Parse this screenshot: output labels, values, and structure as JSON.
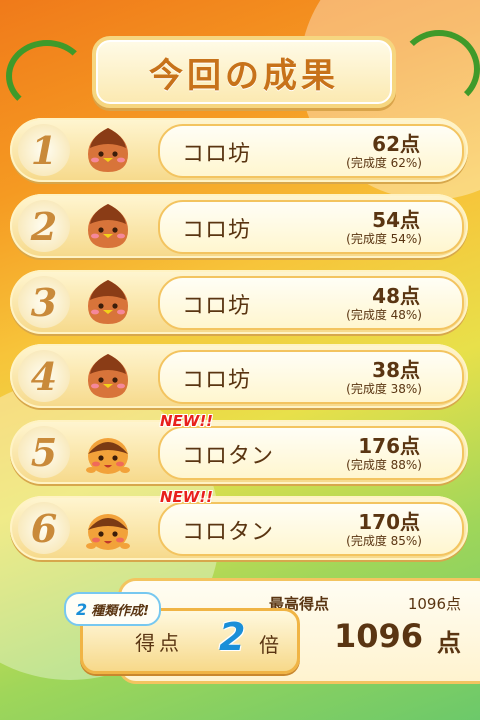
{
  "title": "今回の成果",
  "rows": [
    {
      "rank": "1",
      "name": "コロ坊",
      "score": "62点",
      "completion": "(完成度 62%)",
      "new": "",
      "character": "chestnut-bou-icon"
    },
    {
      "rank": "2",
      "name": "コロ坊",
      "score": "54点",
      "completion": "(完成度 54%)",
      "new": "",
      "character": "chestnut-bou-icon"
    },
    {
      "rank": "3",
      "name": "コロ坊",
      "score": "48点",
      "completion": "(完成度 48%)",
      "new": "",
      "character": "chestnut-bou-icon"
    },
    {
      "rank": "4",
      "name": "コロ坊",
      "score": "38点",
      "completion": "(完成度 38%)",
      "new": "",
      "character": "chestnut-bou-icon"
    },
    {
      "rank": "5",
      "name": "コロタン",
      "score": "176点",
      "completion": "(完成度 88%)",
      "new": "NEW!!",
      "character": "chestnut-tan-icon"
    },
    {
      "rank": "6",
      "name": "コロタン",
      "score": "170点",
      "completion": "(完成度 85%)",
      "new": "NEW!!",
      "character": "chestnut-tan-icon"
    }
  ],
  "best": {
    "label": "最高得点",
    "value": "1096点"
  },
  "total": {
    "value": "1096",
    "unit": "点"
  },
  "bonus": {
    "count": "2",
    "tag_text": "種類作成!",
    "label": "得点",
    "multiplier": "2",
    "unit": "倍"
  },
  "colors": {
    "accent_blue": "#1a8fd8",
    "text_brown": "#5a3512",
    "new_red": "#e8201c"
  }
}
